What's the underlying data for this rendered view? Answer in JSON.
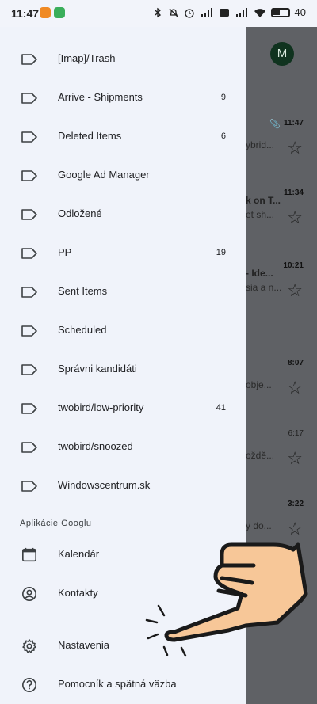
{
  "status_bar": {
    "time": "11:47",
    "battery": "40"
  },
  "background": {
    "avatar_letter": "M",
    "rows": [
      {
        "time": "11:47",
        "line1": "",
        "line2": "ybrid...",
        "bold": true,
        "clip": true
      },
      {
        "time": "11:34",
        "line1": "k on T...",
        "line2": "et sh...",
        "bold": true,
        "clip": false
      },
      {
        "time": "10:21",
        "line1": "- Ide...",
        "line2": "sia a n...",
        "bold": true,
        "clip": false
      },
      {
        "time": "8:07",
        "line1": "",
        "line2": "objе...",
        "bold": true,
        "clip": false
      },
      {
        "time": "6:17",
        "line1": "",
        "line2": "oždě...",
        "bold": false,
        "clip": false
      },
      {
        "time": "3:22",
        "line1": "",
        "line2": "y do...",
        "bold": true,
        "clip": false
      }
    ]
  },
  "drawer": {
    "labels": [
      {
        "label": "[Imap]/Trash",
        "count": ""
      },
      {
        "label": "Arrive - Shipments",
        "count": "9"
      },
      {
        "label": "Deleted Items",
        "count": "6"
      },
      {
        "label": "Google Ad Manager",
        "count": ""
      },
      {
        "label": "Odložené",
        "count": ""
      },
      {
        "label": "PP",
        "count": "19"
      },
      {
        "label": "Sent Items",
        "count": ""
      },
      {
        "label": "Scheduled",
        "count": ""
      },
      {
        "label": "Správni kandidáti",
        "count": ""
      },
      {
        "label": "twobird/low-priority",
        "count": "41"
      },
      {
        "label": "twobird/snoozed",
        "count": ""
      },
      {
        "label": "Windowscentrum.sk",
        "count": ""
      }
    ],
    "apps_section": "Aplikácie Googlu",
    "apps": [
      {
        "label": "Kalendár",
        "icon": "calendar-icon"
      },
      {
        "label": "Kontakty",
        "icon": "contacts-icon"
      }
    ],
    "settings_label": "Nastavenia",
    "help_label": "Pomocník a spätná väzba"
  }
}
